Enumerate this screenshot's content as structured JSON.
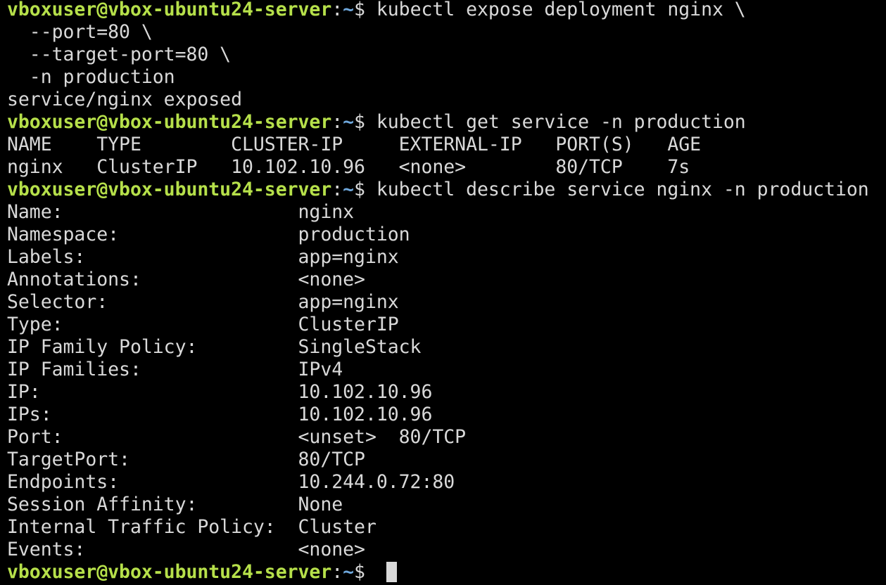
{
  "colors": {
    "background": "#000000",
    "text": "#d9d9d9",
    "prompt_user": "#b6e04a",
    "prompt_path": "#6fa8dc",
    "cursor": "#d9d9d9"
  },
  "prompt": {
    "user_host": "vboxuser@vbox-ubuntu24-server",
    "separator": ":",
    "path": "~",
    "symbol": "$ "
  },
  "lines": [
    {
      "kind": "command",
      "text": "kubectl expose deployment nginx \\"
    },
    {
      "kind": "output",
      "text": "  --port=80 \\"
    },
    {
      "kind": "output",
      "text": "  --target-port=80 \\"
    },
    {
      "kind": "output",
      "text": "  -n production"
    },
    {
      "kind": "output",
      "text": "service/nginx exposed"
    },
    {
      "kind": "command",
      "text": "kubectl get service -n production"
    },
    {
      "kind": "output",
      "text": "NAME    TYPE        CLUSTER-IP     EXTERNAL-IP   PORT(S)   AGE"
    },
    {
      "kind": "output",
      "text": "nginx   ClusterIP   10.102.10.96   <none>        80/TCP    7s"
    },
    {
      "kind": "command",
      "text": "kubectl describe service nginx -n production"
    },
    {
      "kind": "output",
      "text": "Name:                     nginx"
    },
    {
      "kind": "output",
      "text": "Namespace:                production"
    },
    {
      "kind": "output",
      "text": "Labels:                   app=nginx"
    },
    {
      "kind": "output",
      "text": "Annotations:              <none>"
    },
    {
      "kind": "output",
      "text": "Selector:                 app=nginx"
    },
    {
      "kind": "output",
      "text": "Type:                     ClusterIP"
    },
    {
      "kind": "output",
      "text": "IP Family Policy:         SingleStack"
    },
    {
      "kind": "output",
      "text": "IP Families:              IPv4"
    },
    {
      "kind": "output",
      "text": "IP:                       10.102.10.96"
    },
    {
      "kind": "output",
      "text": "IPs:                      10.102.10.96"
    },
    {
      "kind": "output",
      "text": "Port:                     <unset>  80/TCP"
    },
    {
      "kind": "output",
      "text": "TargetPort:               80/TCP"
    },
    {
      "kind": "output",
      "text": "Endpoints:                10.244.0.72:80"
    },
    {
      "kind": "output",
      "text": "Session Affinity:         None"
    },
    {
      "kind": "output",
      "text": "Internal Traffic Policy:  Cluster"
    },
    {
      "kind": "output",
      "text": "Events:                   <none>"
    },
    {
      "kind": "prompt",
      "text": ""
    }
  ]
}
